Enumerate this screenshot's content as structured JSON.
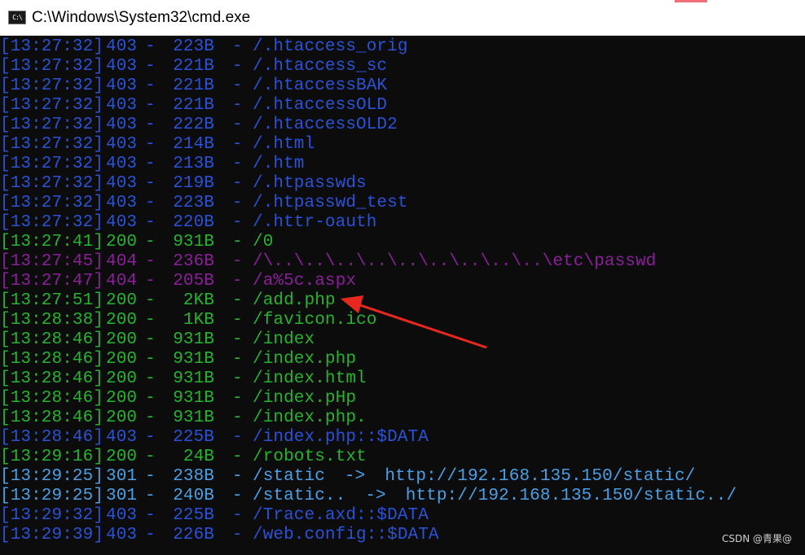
{
  "window": {
    "title": "C:\\Windows\\System32\\cmd.exe",
    "icon_text": "C:\\",
    "icon": "console-icon"
  },
  "colors": {
    "403": "#2b52d6",
    "200": "#25b42e",
    "404": "#8b1f9a",
    "301": "#4aa0e6"
  },
  "lines": [
    {
      "ts": "[13:27:32]",
      "code": "403",
      "size": "223B",
      "path": "/.htaccess_orig",
      "color": "blue"
    },
    {
      "ts": "[13:27:32]",
      "code": "403",
      "size": "221B",
      "path": "/.htaccess_sc",
      "color": "blue"
    },
    {
      "ts": "[13:27:32]",
      "code": "403",
      "size": "221B",
      "path": "/.htaccessBAK",
      "color": "blue"
    },
    {
      "ts": "[13:27:32]",
      "code": "403",
      "size": "221B",
      "path": "/.htaccessOLD",
      "color": "blue"
    },
    {
      "ts": "[13:27:32]",
      "code": "403",
      "size": "222B",
      "path": "/.htaccessOLD2",
      "color": "blue"
    },
    {
      "ts": "[13:27:32]",
      "code": "403",
      "size": "214B",
      "path": "/.html",
      "color": "blue"
    },
    {
      "ts": "[13:27:32]",
      "code": "403",
      "size": "213B",
      "path": "/.htm",
      "color": "blue"
    },
    {
      "ts": "[13:27:32]",
      "code": "403",
      "size": "219B",
      "path": "/.htpasswds",
      "color": "blue"
    },
    {
      "ts": "[13:27:32]",
      "code": "403",
      "size": "223B",
      "path": "/.htpasswd_test",
      "color": "blue"
    },
    {
      "ts": "[13:27:32]",
      "code": "403",
      "size": "220B",
      "path": "/.httr-oauth",
      "color": "blue"
    },
    {
      "ts": "[13:27:41]",
      "code": "200",
      "size": "931B",
      "path": "/0",
      "color": "green"
    },
    {
      "ts": "[13:27:45]",
      "code": "404",
      "size": "236B",
      "path": "/\\..\\..\\..\\..\\..\\..\\..\\..\\..\\etc\\passwd",
      "color": "magenta"
    },
    {
      "ts": "[13:27:47]",
      "code": "404",
      "size": "205B",
      "path": "/a%5c.aspx",
      "color": "magenta"
    },
    {
      "ts": "[13:27:51]",
      "code": "200",
      "size": "2KB",
      "path": "/add.php",
      "color": "green"
    },
    {
      "ts": "[13:28:38]",
      "code": "200",
      "size": "1KB",
      "path": "/favicon.ico",
      "color": "green"
    },
    {
      "ts": "[13:28:46]",
      "code": "200",
      "size": "931B",
      "path": "/index",
      "color": "green"
    },
    {
      "ts": "[13:28:46]",
      "code": "200",
      "size": "931B",
      "path": "/index.php",
      "color": "green"
    },
    {
      "ts": "[13:28:46]",
      "code": "200",
      "size": "931B",
      "path": "/index.html",
      "color": "green"
    },
    {
      "ts": "[13:28:46]",
      "code": "200",
      "size": "931B",
      "path": "/index.pHp",
      "color": "green"
    },
    {
      "ts": "[13:28:46]",
      "code": "200",
      "size": "931B",
      "path": "/index.php.",
      "color": "green"
    },
    {
      "ts": "[13:28:46]",
      "code": "403",
      "size": "225B",
      "path": "/index.php::$DATA",
      "color": "blue"
    },
    {
      "ts": "[13:29:16]",
      "code": "200",
      "size": "24B",
      "path": "/robots.txt",
      "color": "green"
    },
    {
      "ts": "[13:29:25]",
      "code": "301",
      "size": "238B",
      "path": "/static",
      "redirect": "->",
      "url": "http://192.168.135.150/static/",
      "color": "cyan"
    },
    {
      "ts": "[13:29:25]",
      "code": "301",
      "size": "240B",
      "path": "/static..",
      "redirect": "->",
      "url": "http://192.168.135.150/static../",
      "color": "cyan"
    },
    {
      "ts": "[13:29:32]",
      "code": "403",
      "size": "225B",
      "path": "/Trace.axd::$DATA",
      "color": "blue"
    },
    {
      "ts": "[13:29:39]",
      "code": "403",
      "size": "226B",
      "path": "/web.config::$DATA",
      "color": "blue"
    }
  ],
  "separator": "-",
  "annotation": {
    "color": "#e8281e",
    "target": "/add.php",
    "icon": "red-arrow-icon"
  },
  "watermark": "CSDN @青果@"
}
